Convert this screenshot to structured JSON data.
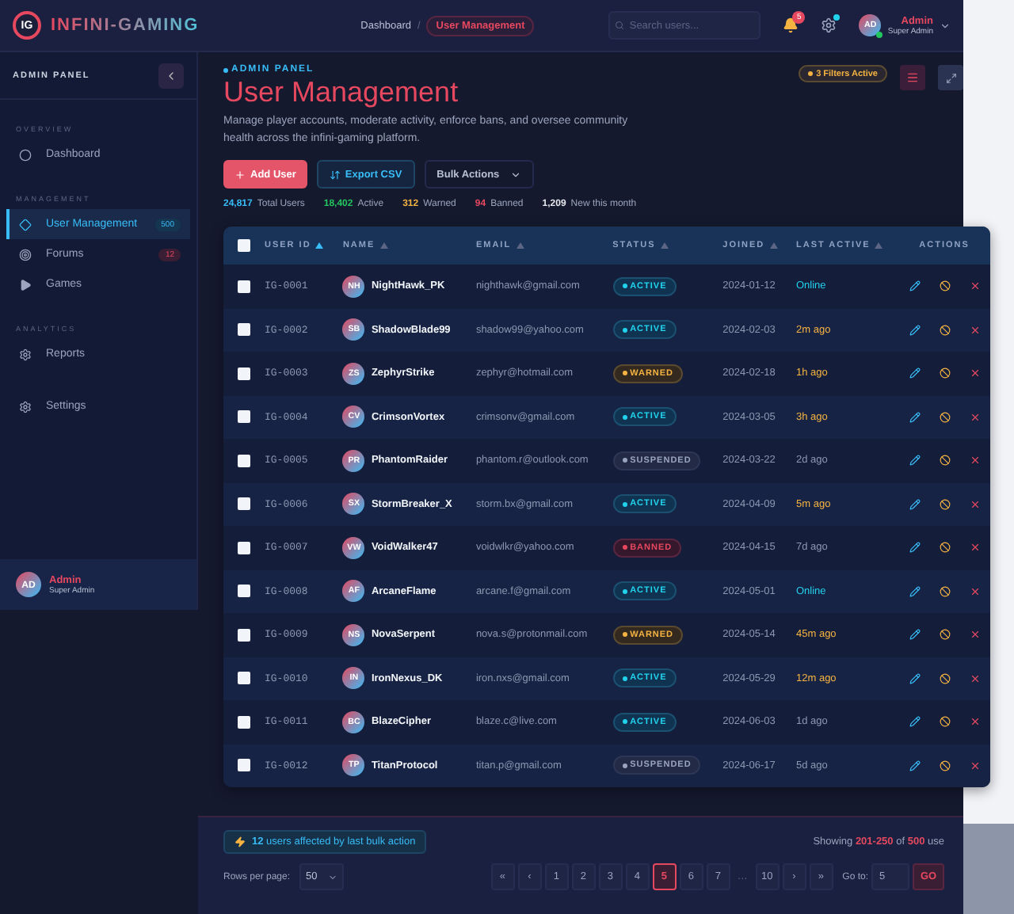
{
  "topbar": {
    "logo": "IG",
    "brand": "INFINI-GAMING",
    "breadcrumb": [
      {
        "label": "Dashboard",
        "selected": false
      },
      {
        "label": "User Management",
        "selected": true
      }
    ],
    "separator": "/",
    "search": {
      "placeholder": "Search users..."
    },
    "notifications": "5",
    "user": {
      "initials": "AD",
      "name": "Admin",
      "role": "Super Admin",
      "online": true
    }
  },
  "sidebar": {
    "title": "ADMIN PANEL",
    "sections": [
      {
        "label": "OVERVIEW",
        "items": [
          {
            "label": "Dashboard",
            "kind": "circle",
            "selected": false
          }
        ]
      },
      {
        "label": "MANAGEMENT",
        "items": [
          {
            "label": "User Management",
            "kind": "diamond",
            "selected": true,
            "badge": {
              "label": "500",
              "kind": "info"
            }
          },
          {
            "label": "Forums",
            "kind": "target",
            "selected": false,
            "badge": {
              "label": "12",
              "kind": "alert"
            }
          },
          {
            "label": "Games",
            "kind": "play",
            "selected": false
          }
        ]
      },
      {
        "label": "ANALYTICS",
        "items": [
          {
            "label": "Reports",
            "kind": "gear",
            "selected": false
          }
        ]
      },
      {
        "items": [
          {
            "label": "Settings",
            "kind": "gear",
            "selected": false
          }
        ]
      }
    ],
    "user": {
      "initials": "AD",
      "name": "Admin",
      "role": "Super Admin"
    }
  },
  "header": {
    "eyebrow": "ADMIN PANEL",
    "title": "User Management",
    "description": "Manage player accounts, moderate activity, enforce bans, and oversee community health across the infini-gaming platform.",
    "filters": "3 Filters Active",
    "actions": [
      {
        "label": "Add User",
        "kind": "primary"
      },
      {
        "label": "Export CSV",
        "kind": "outline"
      },
      {
        "label": "Bulk Actions",
        "kind": "menu"
      }
    ],
    "stats": [
      {
        "value": "24,817",
        "label": "Total Users",
        "color": "#38bdf8"
      },
      {
        "value": "18,402",
        "label": "Active",
        "color": "#22c55e"
      },
      {
        "value": "312",
        "label": "Warned",
        "color": "#f5b342"
      },
      {
        "value": "94",
        "label": "Banned",
        "color": "#e5485f"
      },
      {
        "value": "1,209",
        "label": "New this month",
        "color": "#e5e7eb"
      }
    ]
  },
  "table": {
    "select_all_checked": false,
    "columns": [
      {
        "label": "USER ID",
        "sorted": true
      },
      {
        "label": "NAME",
        "sorted": false
      },
      {
        "label": "EMAIL",
        "sorted": false
      },
      {
        "label": "STATUS",
        "sorted": false
      },
      {
        "label": "JOINED",
        "sorted": false
      },
      {
        "label": "LAST ACTIVE",
        "sorted": false
      },
      {
        "label": "ACTIONS"
      }
    ],
    "rows": [
      {
        "id": "IG-0001",
        "initials": "NH",
        "name": "NightHawk_PK",
        "email": "nighthawk@gmail.com",
        "status": {
          "label": "ACTIVE",
          "kind": "active"
        },
        "joined": "2024-01-12",
        "last_active": {
          "label": "Online",
          "kind": "online"
        },
        "checked": false
      },
      {
        "id": "IG-0002",
        "initials": "SB",
        "name": "ShadowBlade99",
        "email": "shadow99@yahoo.com",
        "status": {
          "label": "ACTIVE",
          "kind": "active"
        },
        "joined": "2024-02-03",
        "last_active": {
          "label": "2m ago",
          "kind": "recent"
        },
        "checked": false
      },
      {
        "id": "IG-0003",
        "initials": "ZS",
        "name": "ZephyrStrike",
        "email": "zephyr@hotmail.com",
        "status": {
          "label": "WARNED",
          "kind": "warned"
        },
        "joined": "2024-02-18",
        "last_active": {
          "label": "1h ago",
          "kind": "recent"
        },
        "checked": false
      },
      {
        "id": "IG-0004",
        "initials": "CV",
        "name": "CrimsonVortex",
        "email": "crimsonv@gmail.com",
        "status": {
          "label": "ACTIVE",
          "kind": "active"
        },
        "joined": "2024-03-05",
        "last_active": {
          "label": "3h ago",
          "kind": "recent"
        },
        "checked": false
      },
      {
        "id": "IG-0005",
        "initials": "PR",
        "name": "PhantomRaider",
        "email": "phantom.r@outlook.com",
        "status": {
          "label": "SUSPENDED",
          "kind": "suspended"
        },
        "joined": "2024-03-22",
        "last_active": {
          "label": "2d ago",
          "kind": "idle"
        },
        "checked": false
      },
      {
        "id": "IG-0006",
        "initials": "SX",
        "name": "StormBreaker_X",
        "email": "storm.bx@gmail.com",
        "status": {
          "label": "ACTIVE",
          "kind": "active"
        },
        "joined": "2024-04-09",
        "last_active": {
          "label": "5m ago",
          "kind": "recent"
        },
        "checked": false
      },
      {
        "id": "IG-0007",
        "initials": "VW",
        "name": "VoidWalker47",
        "email": "voidwlkr@yahoo.com",
        "status": {
          "label": "BANNED",
          "kind": "banned"
        },
        "joined": "2024-04-15",
        "last_active": {
          "label": "7d ago",
          "kind": "idle"
        },
        "checked": false
      },
      {
        "id": "IG-0008",
        "initials": "AF",
        "name": "ArcaneFlame",
        "email": "arcane.f@gmail.com",
        "status": {
          "label": "ACTIVE",
          "kind": "active"
        },
        "joined": "2024-05-01",
        "last_active": {
          "label": "Online",
          "kind": "online"
        },
        "checked": false
      },
      {
        "id": "IG-0009",
        "initials": "NS",
        "name": "NovaSerpent",
        "email": "nova.s@protonmail.com",
        "status": {
          "label": "WARNED",
          "kind": "warned"
        },
        "joined": "2024-05-14",
        "last_active": {
          "label": "45m ago",
          "kind": "recent"
        },
        "checked": false
      },
      {
        "id": "IG-0010",
        "initials": "IN",
        "name": "IronNexus_DK",
        "email": "iron.nxs@gmail.com",
        "status": {
          "label": "ACTIVE",
          "kind": "active"
        },
        "joined": "2024-05-29",
        "last_active": {
          "label": "12m ago",
          "kind": "recent"
        },
        "checked": false
      },
      {
        "id": "IG-0011",
        "initials": "BC",
        "name": "BlazeCipher",
        "email": "blaze.c@live.com",
        "status": {
          "label": "ACTIVE",
          "kind": "active"
        },
        "joined": "2024-06-03",
        "last_active": {
          "label": "1d ago",
          "kind": "idle"
        },
        "checked": false
      },
      {
        "id": "IG-0012",
        "initials": "TP",
        "name": "TitanProtocol",
        "email": "titan.p@gmail.com",
        "status": {
          "label": "SUSPENDED",
          "kind": "suspended"
        },
        "joined": "2024-06-17",
        "last_active": {
          "label": "5d ago",
          "kind": "idle"
        },
        "checked": false
      }
    ]
  },
  "footer": {
    "bulk_note": "**12** users affected by last bulk action",
    "showing": "Showing **201-250** of **500** use",
    "rows_label": "Rows per page:",
    "rows_value": "50",
    "pages": [
      {
        "label": "«",
        "selected": false
      },
      {
        "label": "‹",
        "selected": false
      },
      {
        "label": "1",
        "selected": false
      },
      {
        "label": "2",
        "selected": false
      },
      {
        "label": "3",
        "selected": false
      },
      {
        "label": "4",
        "selected": false
      },
      {
        "label": "5",
        "selected": true
      },
      {
        "label": "6",
        "selected": false
      },
      {
        "label": "7",
        "selected": false
      },
      {
        "label": "…",
        "kind": "gap"
      },
      {
        "label": "10",
        "selected": false
      },
      {
        "label": "›",
        "selected": false
      },
      {
        "label": "»",
        "selected": false
      }
    ],
    "goto_label": "Go to:",
    "goto_value": "5",
    "go": "GO"
  }
}
